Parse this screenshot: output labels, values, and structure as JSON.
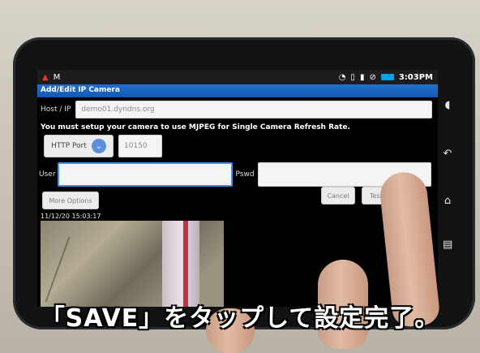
{
  "status_bar": {
    "clock": "3:03PM",
    "icons": [
      "notification-icon",
      "gmail-icon",
      "wifi-icon",
      "vibrate-icon",
      "sd-card-icon",
      "no-signal-icon",
      "battery-icon"
    ]
  },
  "screen": {
    "title": "Add/Edit IP Camera",
    "host_label": "Host / IP",
    "host_value": "demo01.dyndns.org",
    "mjpeg_notice": "You must setup your camera to use MJPEG for Single Camera Refresh Rate.",
    "port_select": "HTTP Port",
    "port_value": "10150",
    "user_label": "User",
    "user_value": "",
    "pswd_label": "Pswd",
    "pswd_value": "",
    "more_options": "More Options",
    "cancel": "Cancel",
    "test": "Test",
    "timestamp": "11/12/20 15:03:17"
  },
  "caption": "「SAVE」をタップして設定完了。",
  "colors": {
    "title_bar": "#1c63c4",
    "focus_border": "#3f8ef0",
    "battery": "#00a0e8"
  }
}
